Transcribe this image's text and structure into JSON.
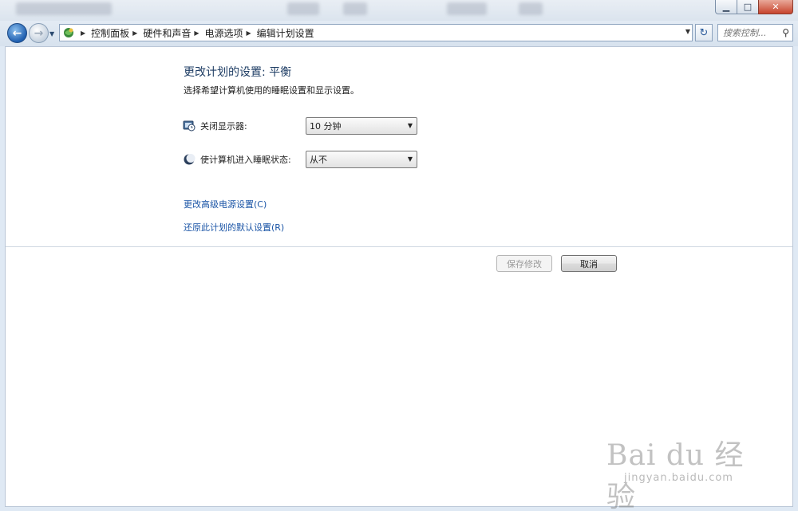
{
  "window": {
    "minimize_glyph": "▁",
    "maximize_glyph": "□",
    "close_glyph": "✕"
  },
  "nav": {
    "back_glyph": "←",
    "forward_glyph": "→",
    "history_glyph": "▼",
    "breadcrumbs": [
      "控制面板",
      "硬件和声音",
      "电源选项",
      "编辑计划设置"
    ],
    "crumb_separator": "▶",
    "address_dropdown_glyph": "▼",
    "refresh_glyph": "↻",
    "search_placeholder": "搜索控制...",
    "search_glyph": "⚲"
  },
  "main": {
    "title": "更改计划的设置: 平衡",
    "description": "选择希望计算机使用的睡眠设置和显示设置。",
    "settings": [
      {
        "label": "关闭显示器:",
        "value": "10 分钟",
        "icon": "monitor-clock-icon"
      },
      {
        "label": "使计算机进入睡眠状态:",
        "value": "从不",
        "icon": "moon-sleep-icon"
      }
    ],
    "dropdown_arrow": "▼",
    "links": {
      "advanced": "更改高级电源设置(C)",
      "restore": "还原此计划的默认设置(R)"
    },
    "buttons": {
      "save": "保存修改",
      "cancel": "取消"
    }
  },
  "watermark": {
    "logo": "Bai du 经验",
    "url": "jingyan.baidu.com"
  },
  "colors": {
    "title": "#1e3d64",
    "link": "#1a54a6",
    "nav_back": "#1f5fb0"
  }
}
